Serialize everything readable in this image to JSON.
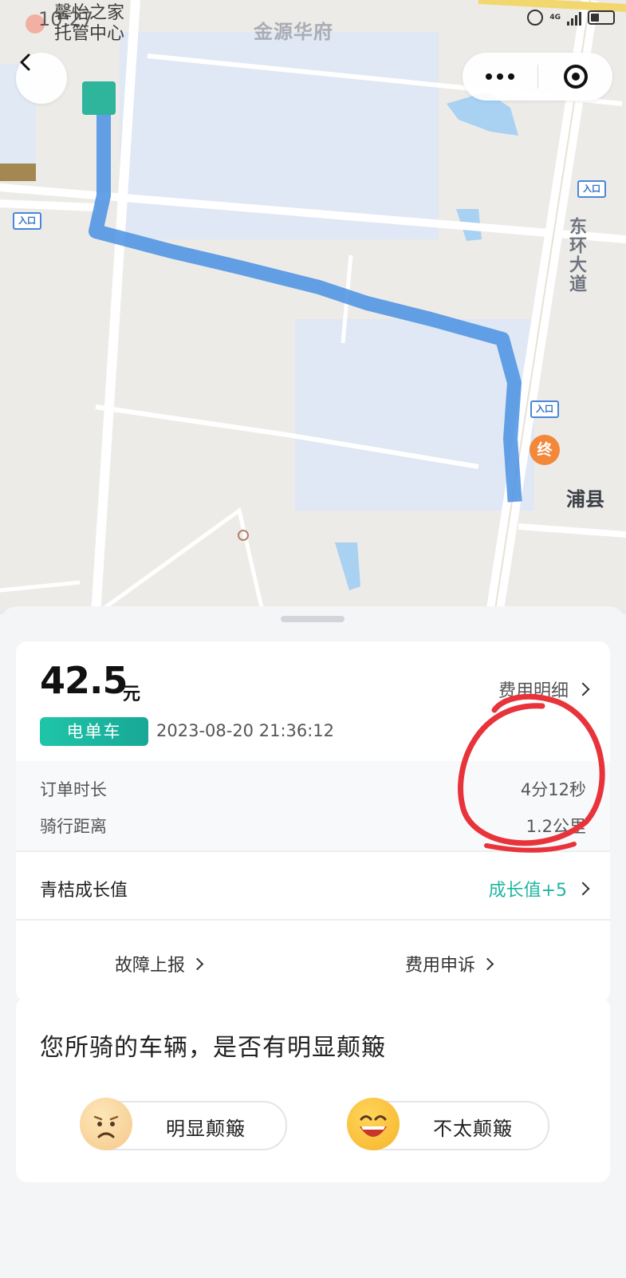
{
  "status_bar": {
    "time": "10:27",
    "network": "4G",
    "overlay_app_line1": "馨怡之家",
    "overlay_app_line2": "托管中心"
  },
  "map": {
    "poi_top": "金源华府",
    "road_name": "东环大道",
    "entry_label": "入口",
    "destination_marker": "终",
    "destination_name": "浦县"
  },
  "order": {
    "price": "42.5",
    "price_unit": "元",
    "fee_detail_label": "费用明细",
    "vehicle_type": "电单车",
    "datetime": "2023-08-20 21:36:12",
    "duration_label": "订单时长",
    "duration_value": "4分12秒",
    "distance_label": "骑行距离",
    "distance_value": "1.2公里",
    "growth_label": "青桔成长值",
    "growth_value": "成长值+5",
    "report_fault": "故障上报",
    "fee_appeal": "费用申诉"
  },
  "survey": {
    "question": "您所骑的车辆，是否有明显颠簸",
    "option_bumpy": "明显颠簸",
    "option_smooth": "不太颠簸"
  },
  "colors": {
    "accent_green": "#21b6a0",
    "annotation_red": "#e8333b",
    "route_blue": "#4a90e2",
    "destination_orange": "#f3873a"
  }
}
